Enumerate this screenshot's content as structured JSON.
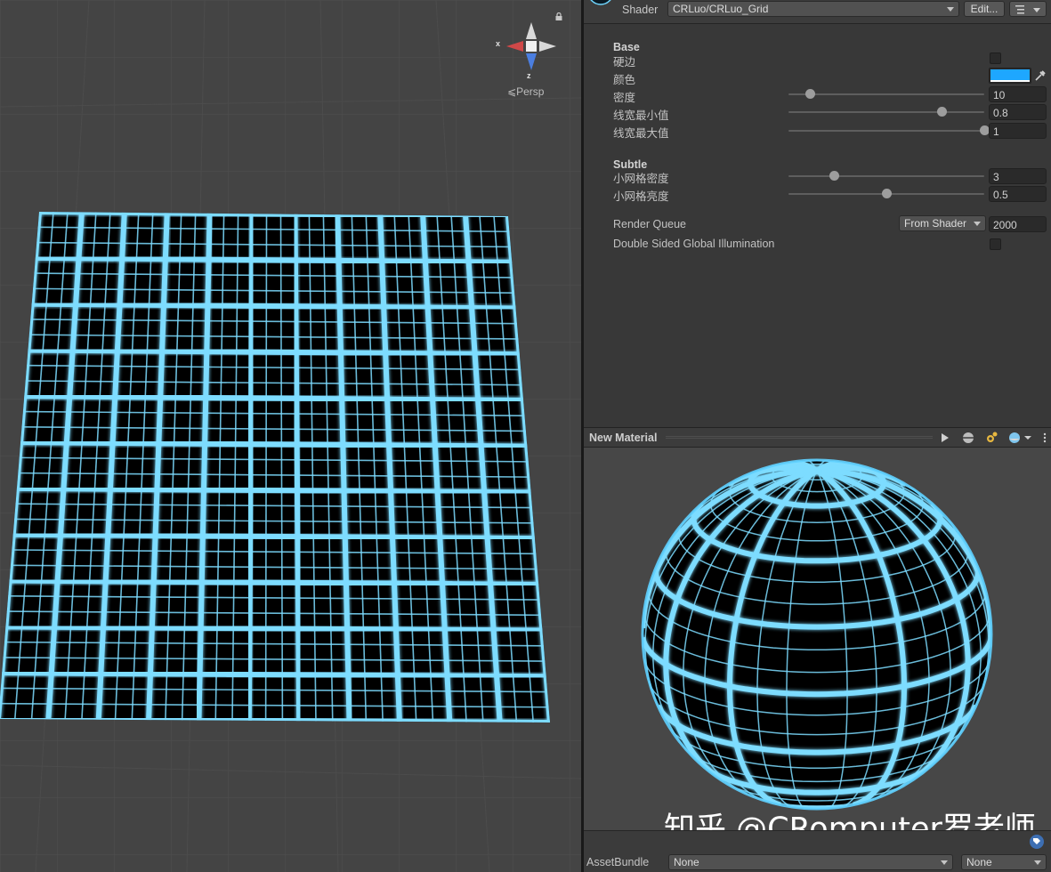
{
  "scene": {
    "view_mode": "Persp",
    "gizmo_axes": {
      "x": "x",
      "z": "z"
    },
    "grid_color": "#7ddcff"
  },
  "inspector": {
    "shader_label": "Shader",
    "shader_value": "CRLuo/CRLuo_Grid",
    "edit_button": "Edit...",
    "sections": {
      "base": "Base",
      "subtle": "Subtle"
    },
    "properties": {
      "hard_edge": {
        "label": "硬边"
      },
      "color": {
        "label": "颜色",
        "value": "#1ea7ff"
      },
      "density": {
        "label": "密度",
        "value": "10",
        "fraction": 0.11
      },
      "line_min": {
        "label": "线宽最小值",
        "value": "0.8",
        "fraction": 0.78
      },
      "line_max": {
        "label": "线宽最大值",
        "value": "1",
        "fraction": 1.0
      },
      "small_density": {
        "label": "小网格密度",
        "value": "3",
        "fraction": 0.23
      },
      "small_brightness": {
        "label": "小网格亮度",
        "value": "0.5",
        "fraction": 0.5
      }
    },
    "render_queue": {
      "label": "Render Queue",
      "mode": "From Shader",
      "value": "2000"
    },
    "double_sided_gi": {
      "label": "Double Sided Global Illumination"
    }
  },
  "preview": {
    "title": "New Material",
    "watermark": "知乎 @CRomputer罗老师"
  },
  "asset_bundle": {
    "label": "AssetBundle",
    "bundle": "None",
    "variant": "None"
  }
}
